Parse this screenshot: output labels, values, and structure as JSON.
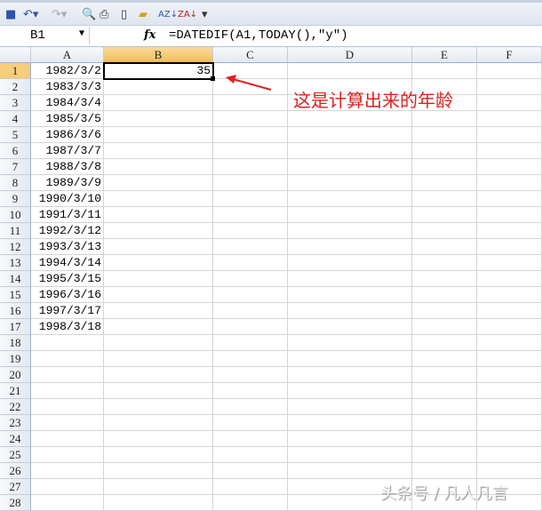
{
  "toolbar": {
    "items": [
      "save-icon",
      "undo-icon",
      "redo-icon",
      "print-preview-icon",
      "print-icon",
      "new-icon",
      "open-icon",
      "sort-asc-icon",
      "sort-desc-icon",
      "customize-icon"
    ]
  },
  "formula_bar": {
    "name_box": "B1",
    "fx_label": "fx",
    "formula": "=DATEDIF(A1,TODAY(),\"y\")"
  },
  "columns": [
    "A",
    "B",
    "C",
    "D",
    "E",
    "F"
  ],
  "rows": [
    "1",
    "2",
    "3",
    "4",
    "5",
    "6",
    "7",
    "8",
    "9",
    "10",
    "11",
    "12",
    "13",
    "14",
    "15",
    "16",
    "17",
    "18",
    "19",
    "20",
    "21",
    "22",
    "23",
    "24",
    "25",
    "26",
    "27",
    "28"
  ],
  "colA": [
    "1982/3/2",
    "1983/3/3",
    "1984/3/4",
    "1985/3/5",
    "1986/3/6",
    "1987/3/7",
    "1988/3/8",
    "1989/3/9",
    "1990/3/10",
    "1991/3/11",
    "1992/3/12",
    "1993/3/13",
    "1994/3/14",
    "1995/3/15",
    "1996/3/16",
    "1997/3/17",
    "1998/3/18"
  ],
  "b1": "35",
  "annotation": "这是计算出来的年龄",
  "watermark": "头条号 / 凡人凡言",
  "colors": {
    "annotation": "#e02020",
    "selected_header": "#f1c15f"
  }
}
